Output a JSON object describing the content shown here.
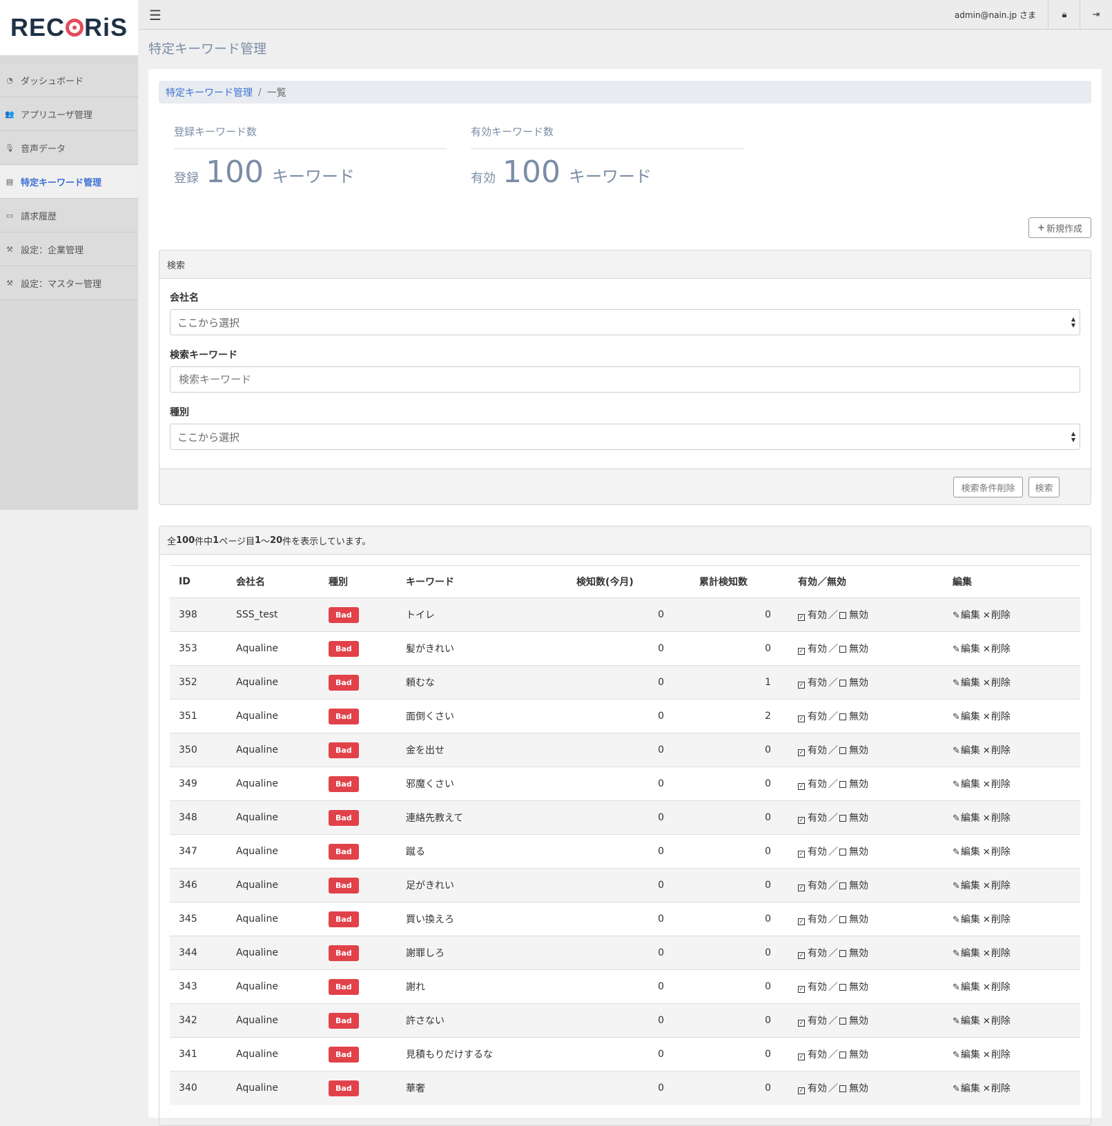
{
  "brand": {
    "logo_text_pre": "REC",
    "logo_text_post": "RiS"
  },
  "sidebar": {
    "items": [
      {
        "label": "ダッシュボード",
        "icon": "dashboard-icon",
        "glyph": "◔",
        "active": false
      },
      {
        "label": "アプリユーザ管理",
        "icon": "users-icon",
        "glyph": "👥",
        "active": false
      },
      {
        "label": "音声データ",
        "icon": "microphone-icon",
        "glyph": "🎙",
        "active": false
      },
      {
        "label": "特定キーワード管理",
        "icon": "document-icon",
        "glyph": "▤",
        "active": true
      },
      {
        "label": "請求履歴",
        "icon": "money-icon",
        "glyph": "▭",
        "active": false
      },
      {
        "label": "設定：企業管理",
        "icon": "wrench-icon",
        "glyph": "⚒",
        "active": false
      },
      {
        "label": "設定：マスター管理",
        "icon": "wrench-icon",
        "glyph": "⚒",
        "active": false
      }
    ]
  },
  "topbar": {
    "user": "admin@nain.jp さま"
  },
  "page": {
    "title": "特定キーワード管理",
    "breadcrumb_link": "特定キーワード管理",
    "breadcrumb_sep": "/",
    "breadcrumb_current": "一覧"
  },
  "stats": {
    "registered": {
      "label": "登録キーワード数",
      "prefix": "登録",
      "value": "100",
      "suffix": "キーワード"
    },
    "active": {
      "label": "有効キーワード数",
      "prefix": "有効",
      "value": "100",
      "suffix": "キーワード"
    }
  },
  "new_button": "新規作成",
  "search": {
    "heading": "検索",
    "company_label": "会社名",
    "company_value": "ここから選択",
    "keyword_label": "検索キーワード",
    "keyword_placeholder": "検索キーワード",
    "type_label": "種別",
    "type_value": "ここから選択",
    "clear_button": "検索条件削除",
    "search_button": "検索"
  },
  "list": {
    "summary_total": "100",
    "summary_page": "1",
    "summary_from": "1",
    "summary_to": "20",
    "columns": [
      "ID",
      "会社名",
      "種別",
      "キーワード",
      "検知数(今月)",
      "累計検知数",
      "有効／無効",
      "編集"
    ],
    "enable_label": "有効",
    "disable_label": "無効",
    "slash": "／",
    "edit_label": "編集",
    "delete_label": "削除",
    "rows": [
      {
        "id": "398",
        "company": "SSS_test",
        "type": "Bad",
        "keyword": "トイレ",
        "month": "0",
        "total": "0"
      },
      {
        "id": "353",
        "company": "Aqualine",
        "type": "Bad",
        "keyword": "髪がきれい",
        "month": "0",
        "total": "0"
      },
      {
        "id": "352",
        "company": "Aqualine",
        "type": "Bad",
        "keyword": "頼むな",
        "month": "0",
        "total": "1"
      },
      {
        "id": "351",
        "company": "Aqualine",
        "type": "Bad",
        "keyword": "面倒くさい",
        "month": "0",
        "total": "2"
      },
      {
        "id": "350",
        "company": "Aqualine",
        "type": "Bad",
        "keyword": "金を出せ",
        "month": "0",
        "total": "0"
      },
      {
        "id": "349",
        "company": "Aqualine",
        "type": "Bad",
        "keyword": "邪魔くさい",
        "month": "0",
        "total": "0"
      },
      {
        "id": "348",
        "company": "Aqualine",
        "type": "Bad",
        "keyword": "連絡先教えて",
        "month": "0",
        "total": "0"
      },
      {
        "id": "347",
        "company": "Aqualine",
        "type": "Bad",
        "keyword": "蹴る",
        "month": "0",
        "total": "0"
      },
      {
        "id": "346",
        "company": "Aqualine",
        "type": "Bad",
        "keyword": "足がきれい",
        "month": "0",
        "total": "0"
      },
      {
        "id": "345",
        "company": "Aqualine",
        "type": "Bad",
        "keyword": "買い換えろ",
        "month": "0",
        "total": "0"
      },
      {
        "id": "344",
        "company": "Aqualine",
        "type": "Bad",
        "keyword": "謝罪しろ",
        "month": "0",
        "total": "0"
      },
      {
        "id": "343",
        "company": "Aqualine",
        "type": "Bad",
        "keyword": "謝れ",
        "month": "0",
        "total": "0"
      },
      {
        "id": "342",
        "company": "Aqualine",
        "type": "Bad",
        "keyword": "許さない",
        "month": "0",
        "total": "0"
      },
      {
        "id": "341",
        "company": "Aqualine",
        "type": "Bad",
        "keyword": "見積もりだけするな",
        "month": "0",
        "total": "0"
      },
      {
        "id": "340",
        "company": "Aqualine",
        "type": "Bad",
        "keyword": "華奢",
        "month": "0",
        "total": "0"
      }
    ]
  },
  "colors": {
    "accent": "#3b73d6",
    "badge_bad": "#e1424a",
    "muted_title": "#7b8da5",
    "logo_dark": "#1e3146",
    "logo_ring": "#e24c5c"
  }
}
